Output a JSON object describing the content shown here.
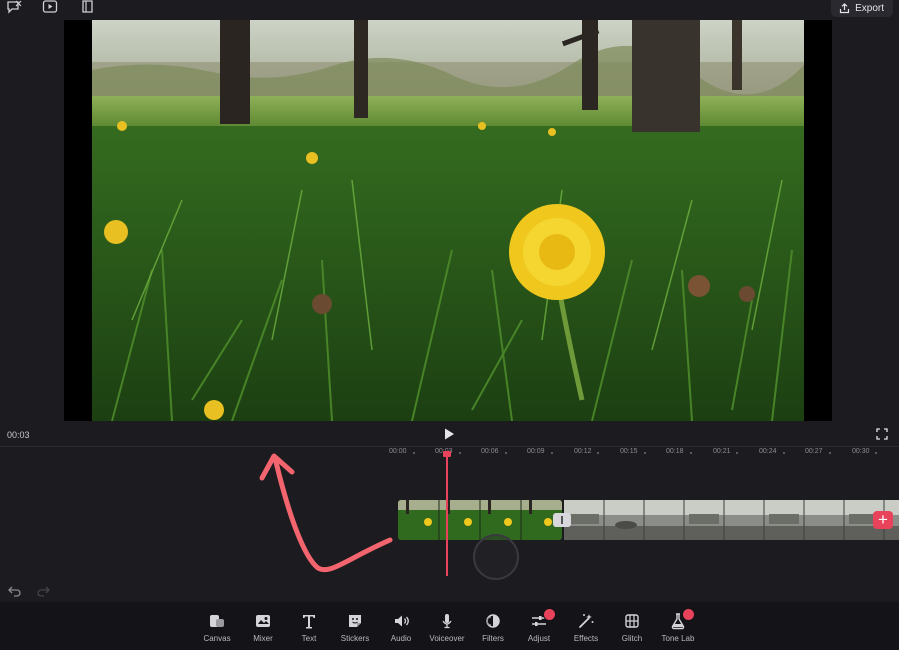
{
  "header": {
    "export_label": "Export",
    "icons": [
      "chat-cross-icon",
      "play-window-icon",
      "book-icon"
    ]
  },
  "player": {
    "current_time": "00:03"
  },
  "timeline": {
    "ruler": [
      "00:00",
      "00:03",
      "00:06",
      "00:09",
      "00:12",
      "00:15",
      "00:18",
      "00:21",
      "00:24",
      "00:27",
      "00:30"
    ]
  },
  "toolbar": {
    "items": [
      {
        "label": "Canvas",
        "icon": "canvas-icon"
      },
      {
        "label": "Mixer",
        "icon": "mixer-icon"
      },
      {
        "label": "Text",
        "icon": "text-icon"
      },
      {
        "label": "Stickers",
        "icon": "sticker-icon"
      },
      {
        "label": "Audio",
        "icon": "speaker-icon"
      },
      {
        "label": "Voiceover",
        "icon": "microphone-icon"
      },
      {
        "label": "Filters",
        "icon": "filter-icon"
      },
      {
        "label": "Adjust",
        "icon": "sliders-icon",
        "badge": true
      },
      {
        "label": "Effects",
        "icon": "magic-wand-icon"
      },
      {
        "label": "Glitch",
        "icon": "glitch-icon"
      },
      {
        "label": "Tone Lab",
        "icon": "flask-icon",
        "badge": true
      }
    ]
  },
  "colors": {
    "accent": "#e8435a",
    "background": "#1c1b20",
    "toolbar_bg": "#141318"
  }
}
